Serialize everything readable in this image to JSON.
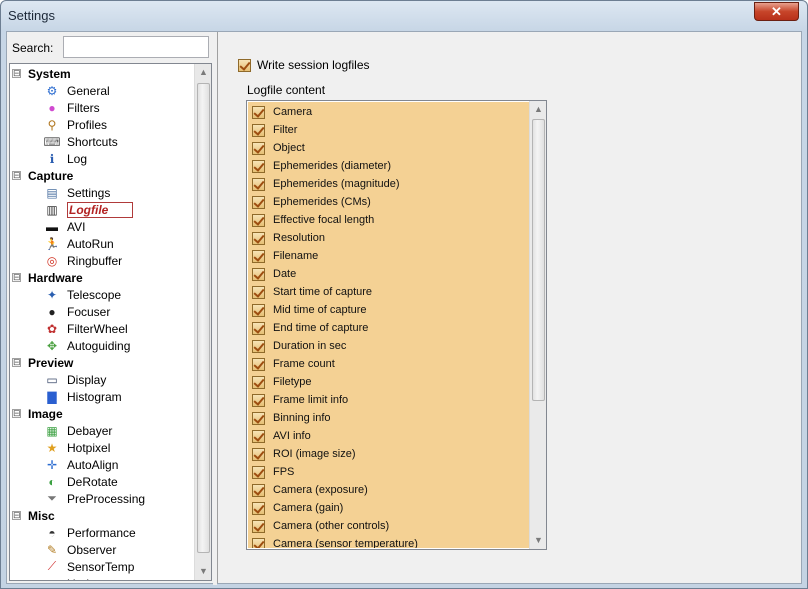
{
  "window": {
    "title": "Settings",
    "close_label": "✕"
  },
  "search": {
    "label": "Search:",
    "value": ""
  },
  "tree": {
    "categories": [
      {
        "label": "System",
        "toggle": "⊟",
        "items": [
          {
            "label": "General",
            "icon": "gear-icon",
            "glyph": "⚙",
            "color": "#2a6bd0"
          },
          {
            "label": "Filters",
            "icon": "color-wheel-icon",
            "glyph": "●",
            "color": "#d04ad0"
          },
          {
            "label": "Profiles",
            "icon": "profiles-icon",
            "glyph": "⚲",
            "color": "#b0761e"
          },
          {
            "label": "Shortcuts",
            "icon": "keyboard-icon",
            "glyph": "⌨",
            "color": "#666666"
          },
          {
            "label": "Log",
            "icon": "info-icon",
            "glyph": "ℹ",
            "color": "#2a5db0"
          }
        ]
      },
      {
        "label": "Capture",
        "toggle": "⊟",
        "items": [
          {
            "label": "Settings",
            "icon": "capture-settings-icon",
            "glyph": "▤",
            "color": "#4a6fa0"
          },
          {
            "label": "Logfile",
            "icon": "logfile-icon",
            "glyph": "▥",
            "color": "#333333",
            "selected": true
          },
          {
            "label": "AVI",
            "icon": "avi-icon",
            "glyph": "▬",
            "color": "#111111"
          },
          {
            "label": "AutoRun",
            "icon": "running-man-icon",
            "glyph": "🏃",
            "color": "#2a8ad8"
          },
          {
            "label": "Ringbuffer",
            "icon": "lifebuoy-icon",
            "glyph": "◎",
            "color": "#d03020"
          }
        ]
      },
      {
        "label": "Hardware",
        "toggle": "⊟",
        "items": [
          {
            "label": "Telescope",
            "icon": "telescope-icon",
            "glyph": "✦",
            "color": "#2a5fb0"
          },
          {
            "label": "Focuser",
            "icon": "focuser-icon",
            "glyph": "●",
            "color": "#222222"
          },
          {
            "label": "FilterWheel",
            "icon": "filterwheel-icon",
            "glyph": "✿",
            "color": "#c03030"
          },
          {
            "label": "Autoguiding",
            "icon": "autoguiding-icon",
            "glyph": "✥",
            "color": "#4aa040"
          }
        ]
      },
      {
        "label": "Preview",
        "toggle": "⊟",
        "items": [
          {
            "label": "Display",
            "icon": "monitor-icon",
            "glyph": "▭",
            "color": "#3a4a6a"
          },
          {
            "label": "Histogram",
            "icon": "histogram-icon",
            "glyph": "▇",
            "color": "#2a5fd0"
          }
        ]
      },
      {
        "label": "Image",
        "toggle": "⊟",
        "items": [
          {
            "label": "Debayer",
            "icon": "debayer-icon",
            "glyph": "▦",
            "color": "#3aa040"
          },
          {
            "label": "Hotpixel",
            "icon": "hotpixel-icon",
            "glyph": "★",
            "color": "#e0a020"
          },
          {
            "label": "AutoAlign",
            "icon": "autoalign-icon",
            "glyph": "✛",
            "color": "#2a6bd0"
          },
          {
            "label": "DeRotate",
            "icon": "derotate-icon",
            "glyph": "◐",
            "color": "#3aa040"
          },
          {
            "label": "PreProcessing",
            "icon": "funnel-icon",
            "glyph": "⏷",
            "color": "#777777"
          }
        ]
      },
      {
        "label": "Misc",
        "toggle": "⊟",
        "items": [
          {
            "label": "Performance",
            "icon": "performance-icon",
            "glyph": "◓",
            "color": "#333333"
          },
          {
            "label": "Observer",
            "icon": "observer-icon",
            "glyph": "✎",
            "color": "#b07a1e"
          },
          {
            "label": "SensorTemp",
            "icon": "thermometer-icon",
            "glyph": "⟋",
            "color": "#d03030"
          },
          {
            "label": "Update",
            "icon": "update-icon",
            "glyph": "▾",
            "color": "#2a6bd0"
          }
        ]
      }
    ],
    "scroll": {
      "up": "▲",
      "down": "▼"
    }
  },
  "logfile": {
    "write_session_label": "Write session logfiles",
    "write_session_checked": true,
    "content_label": "Logfile content",
    "items": [
      "Camera",
      "Filter",
      "Object",
      "Ephemerides (diameter)",
      "Ephemerides (magnitude)",
      "Ephemerides (CMs)",
      "Effective focal length",
      "Resolution",
      "Filename",
      "Date",
      "Start time of capture",
      "Mid time of capture",
      "End time of capture",
      "Duration in sec",
      "Frame count",
      "Filetype",
      "Frame limit info",
      "Binning info",
      "AVI info",
      "ROI (image size)",
      "FPS",
      "Camera (exposure)",
      "Camera (gain)",
      "Camera (other controls)",
      "Camera (sensor temperature)"
    ],
    "scroll": {
      "up": "▲",
      "down": "▼"
    }
  }
}
